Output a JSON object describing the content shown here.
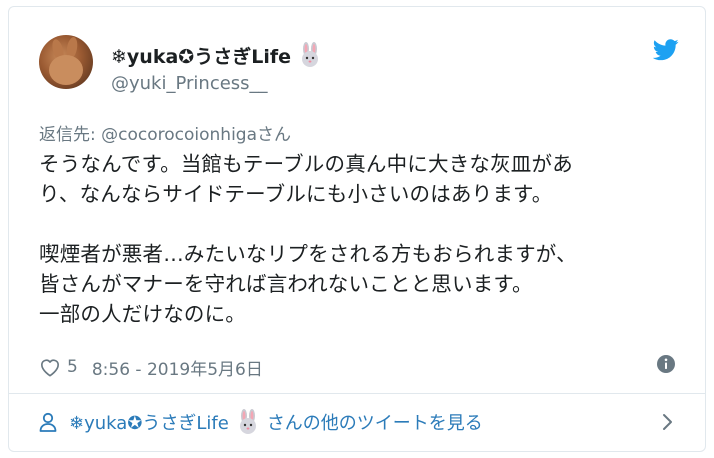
{
  "tweet": {
    "author": {
      "display_name": "❄yuka✪うさぎLife",
      "handle": "@yuki_Princess__",
      "avatar": "rabbit-photo-avatar"
    },
    "reply_to": {
      "prefix": "返信先: ",
      "handle": "@cocorocoionhiga",
      "suffix": "さん"
    },
    "text_lines": [
      "そうなんです。当館もテーブルの真ん中に大きな灰皿があ",
      "り、なんならサイドテーブルにも小さいのはあります。",
      "",
      "喫煙者が悪者…みたいなリプをされる方もおられますが、",
      "皆さんがマナーを守れば言われないことと思います。",
      "一部の人だけなのに。"
    ],
    "likes": "5",
    "timestamp": "8:56 - 2019年5月6日"
  },
  "footer": {
    "name": "❄yuka✪うさぎLife",
    "suffix": "さんの他のツイートを見る"
  },
  "icons": {
    "brand": "twitter-bird-icon",
    "like": "heart-icon",
    "info": "info-icon",
    "footer": "person-icon",
    "chevron": "chevron-right-icon",
    "name_emoji": "rabbit-emoji-icon"
  },
  "colors": {
    "twitter_blue": "#1da1f2",
    "link_blue": "#2b7bb9",
    "secondary_text": "#697882",
    "primary_text": "#1c2022",
    "border": "#e1e8ed"
  }
}
